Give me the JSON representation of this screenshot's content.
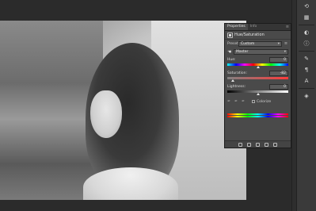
{
  "panel": {
    "tabs": [
      {
        "label": "Properties",
        "active": true
      },
      {
        "label": "Info",
        "active": false
      }
    ],
    "menu_glyph": "≡",
    "title": "Hue/Saturation",
    "preset": {
      "label": "Preset:",
      "value": "Custom"
    },
    "channel": {
      "value": "Master"
    },
    "hue": {
      "label": "Hue:",
      "value": "0",
      "position": 0.5
    },
    "saturation": {
      "label": "Saturation:",
      "value": "-82",
      "position": 0.09
    },
    "lightness": {
      "label": "Lightness:",
      "value": "0",
      "position": 0.5
    },
    "colorize": {
      "label": "Colorize",
      "checked": false
    },
    "footer_icons": [
      "clip-to-layer-icon",
      "view-previous-icon",
      "eye-icon",
      "reset-icon",
      "trash-icon"
    ]
  },
  "toolbar": {
    "icons": [
      {
        "name": "history-icon",
        "glyph": "⟲"
      },
      {
        "name": "swatches-icon",
        "glyph": "▦"
      },
      {
        "name": "adjustments-icon",
        "glyph": "◐"
      },
      {
        "name": "info-icon",
        "glyph": "ⓘ"
      },
      {
        "name": "brush-icon",
        "glyph": "✎"
      },
      {
        "name": "paragraph-icon",
        "glyph": "¶"
      },
      {
        "name": "character-icon",
        "glyph": "A"
      },
      {
        "name": "layers-icon",
        "glyph": "◈"
      }
    ]
  }
}
